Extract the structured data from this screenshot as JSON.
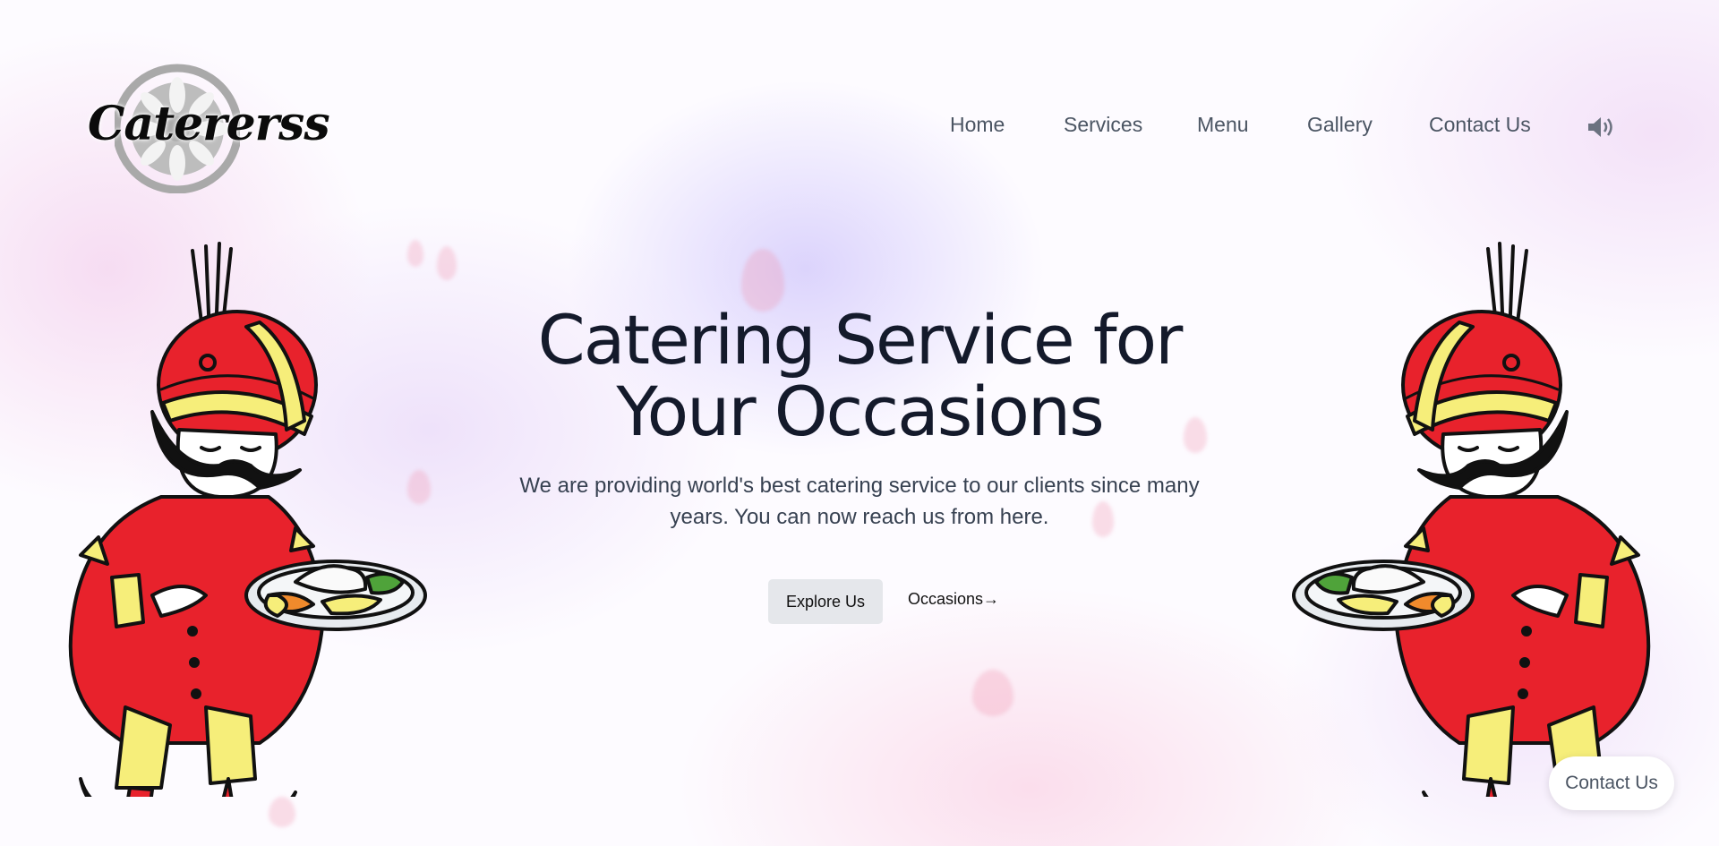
{
  "brand": {
    "logo_text": "Catererss"
  },
  "nav": {
    "items": [
      {
        "label": "Home"
      },
      {
        "label": "Services"
      },
      {
        "label": "Menu"
      },
      {
        "label": "Gallery"
      },
      {
        "label": "Contact Us"
      }
    ],
    "sound_icon": "speaker-icon"
  },
  "hero": {
    "title_line1": "Catering Service for",
    "title_line2": "Your Occasions",
    "subtitle": "We are providing world's best catering service to our clients since many years. You can now reach us from here.",
    "primary_button": "Explore Us",
    "secondary_link": "Occasions→"
  },
  "floating": {
    "contact_label": "Contact Us"
  },
  "colors": {
    "turban_red": "#e8222c",
    "turban_yellow": "#f6ee7a",
    "title": "#141a2b",
    "nav_text": "#4b5563"
  }
}
